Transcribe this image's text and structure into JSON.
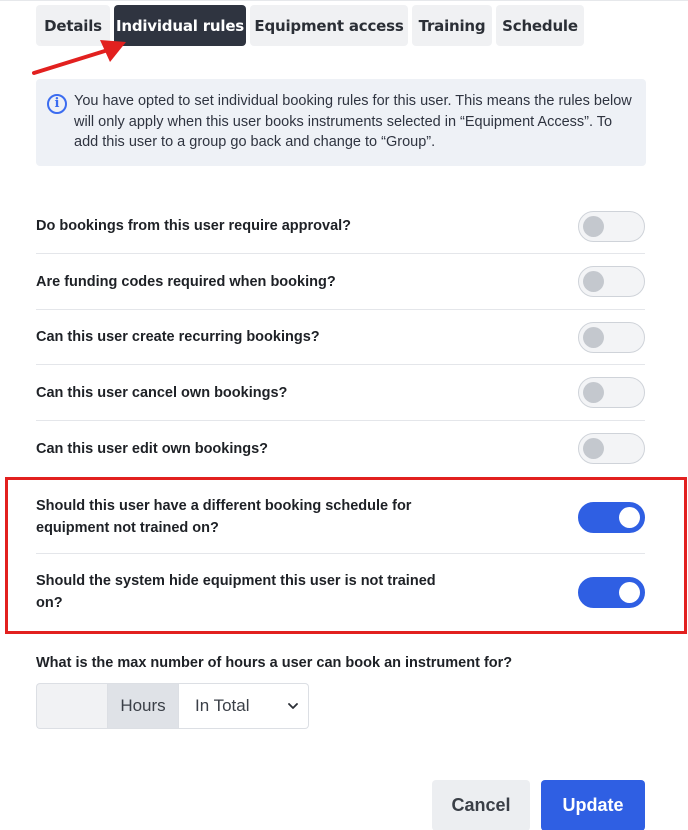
{
  "tabs": [
    {
      "label": "Details",
      "active": false
    },
    {
      "label": "Individual rules",
      "active": true
    },
    {
      "label": "Equipment access",
      "active": false
    },
    {
      "label": "Training",
      "active": false
    },
    {
      "label": "Schedule",
      "active": false
    }
  ],
  "info": {
    "icon": "info-icon",
    "text": "You have opted to set individual booking rules for this user. This means the rules below will only apply when this user books instruments selected in “Equipment Access”. To add this user to a group go back and change to “Group”."
  },
  "rules": [
    {
      "label": "Do bookings from this user require approval?",
      "enabled": false
    },
    {
      "label": "Are funding codes required when booking?",
      "enabled": false
    },
    {
      "label": "Can this user create recurring bookings?",
      "enabled": false
    },
    {
      "label": "Can this user cancel own bookings?",
      "enabled": false
    },
    {
      "label": "Can this user edit own bookings?",
      "enabled": false
    },
    {
      "label": "Should this user have a different booking schedule for equipment not trained on?",
      "enabled": true
    },
    {
      "label": "Should the system hide equipment this user is not trained on?",
      "enabled": true
    }
  ],
  "max_hours": {
    "label": "What is the max number of hours a user can book an instrument for?",
    "value": "",
    "unit": "Hours",
    "period": "In Total"
  },
  "buttons": {
    "cancel": "Cancel",
    "update": "Update"
  },
  "colors": {
    "accent": "#2f5fe3",
    "highlight": "#e2201f",
    "active_tab": "#2f3440"
  }
}
